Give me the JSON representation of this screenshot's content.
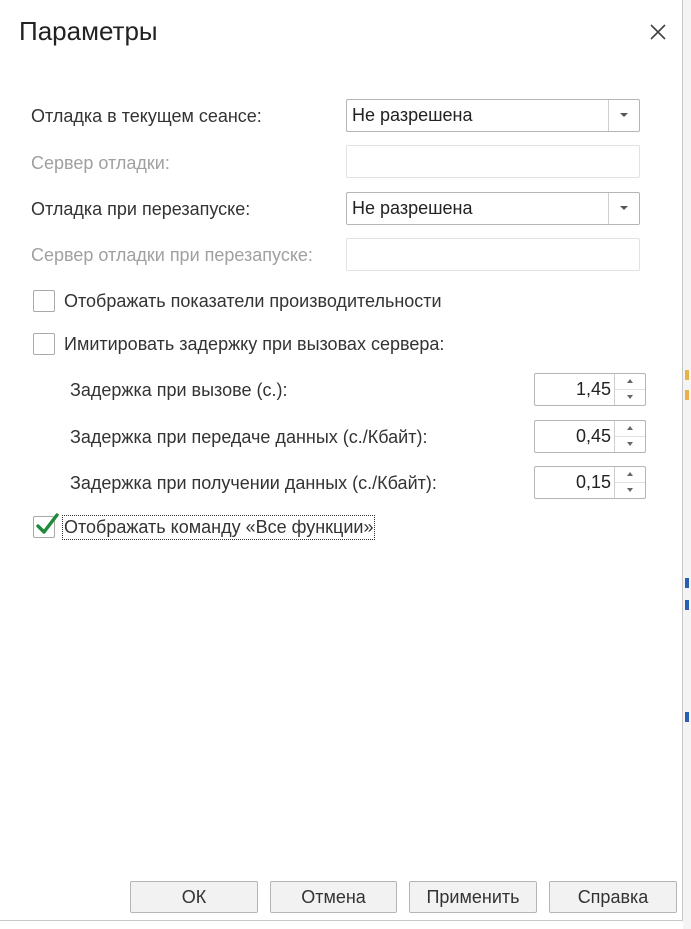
{
  "dialog": {
    "title": "Параметры"
  },
  "fields": {
    "debug_current_label": "Отладка в текущем сеансе:",
    "debug_current_value": "Не разрешена",
    "debug_server_label": "Сервер отладки:",
    "debug_server_value": "",
    "debug_restart_label": "Отладка при перезапуске:",
    "debug_restart_value": "Не разрешена",
    "debug_server_restart_label": "Сервер отладки при перезапуске:",
    "debug_server_restart_value": ""
  },
  "checkboxes": {
    "show_performance_label": "Отображать показатели производительности",
    "show_performance_checked": false,
    "simulate_delay_label": "Имитировать задержку при вызовах сервера:",
    "simulate_delay_checked": false,
    "show_all_functions_label": "Отображать команду «Все функции»",
    "show_all_functions_checked": true
  },
  "delays": {
    "call_label": "Задержка при вызове (с.):",
    "call_value": "1,45",
    "send_label": "Задержка при передаче данных (с./Кбайт):",
    "send_value": "0,45",
    "receive_label": "Задержка при получении данных (с./Кбайт):",
    "receive_value": "0,15"
  },
  "buttons": {
    "ok": "ОК",
    "cancel": "Отмена",
    "apply": "Применить",
    "help": "Справка"
  },
  "colors": {
    "check_accent": "#1f8a3c",
    "disabled_text": "#a0a0a0",
    "border": "#b5b5b5"
  }
}
